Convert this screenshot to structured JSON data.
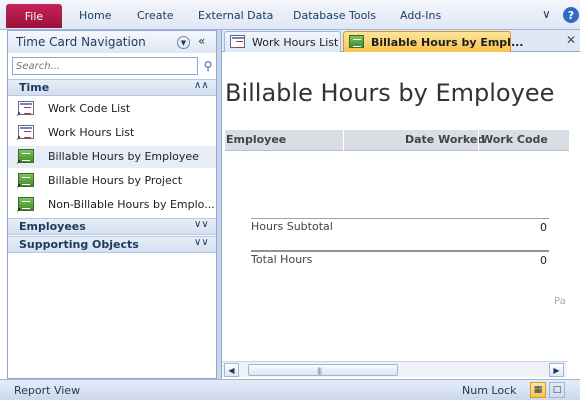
{
  "ribbon": {
    "file_label": "File",
    "tabs": [
      "Home",
      "Create",
      "External Data",
      "Database Tools",
      "Add-Ins"
    ]
  },
  "nav": {
    "title": "Time Card Navigation",
    "search_placeholder": "Search...",
    "groups": {
      "time": "Time",
      "employees": "Employees",
      "supporting": "Supporting Objects"
    },
    "items": [
      {
        "label": "Work Code List",
        "type": "form"
      },
      {
        "label": "Work Hours List",
        "type": "form"
      },
      {
        "label": "Billable Hours by Employee",
        "type": "report"
      },
      {
        "label": "Billable Hours by Project",
        "type": "report"
      },
      {
        "label": "Non-Billable Hours by Emplo...",
        "type": "report"
      }
    ]
  },
  "doc_tabs": [
    {
      "label": "Work Hours List",
      "active": false
    },
    {
      "label": "Billable Hours by Empl...",
      "active": true
    }
  ],
  "report": {
    "title": "Billable Hours by Employee",
    "columns": [
      "Employee",
      "Date Worked",
      "Work Code"
    ],
    "subtotal_label": "Hours Subtotal",
    "subtotal_value": "0",
    "total_label": "Total Hours",
    "total_value": "0",
    "page_fragment": "Pa"
  },
  "scrollbar": {
    "grip": "|||"
  },
  "status": {
    "left": "Report View",
    "right": "Num Lock"
  }
}
